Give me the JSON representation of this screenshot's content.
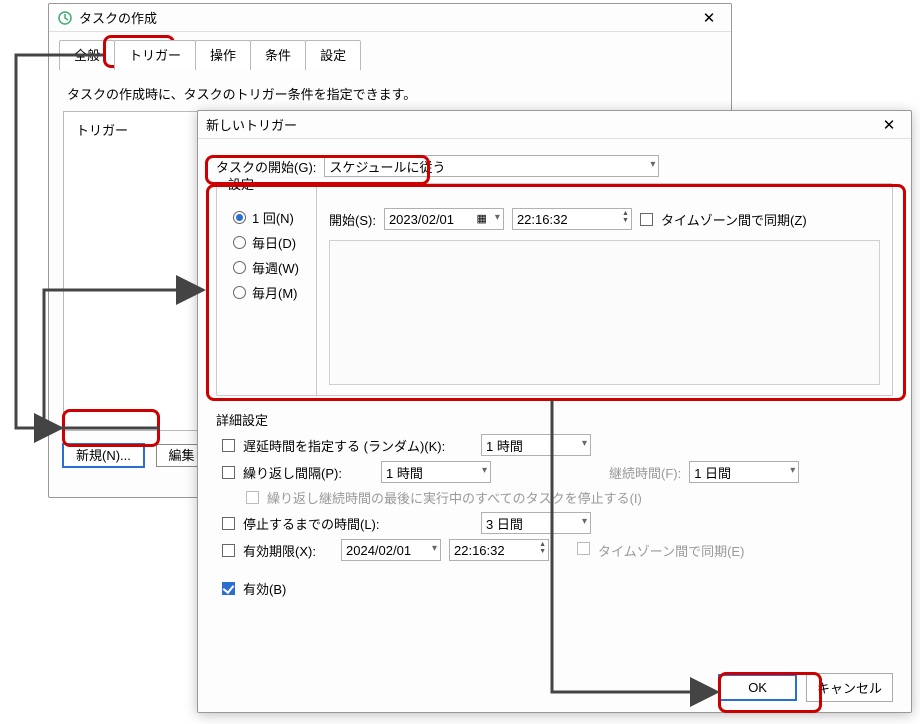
{
  "back": {
    "title": "タスクの作成",
    "close": "✕",
    "tabs": {
      "general": "全般",
      "triggers": "トリガー",
      "actions": "操作",
      "conditions": "条件",
      "settings": "設定"
    },
    "desc": "タスクの作成時に、タスクのトリガー条件を指定できます。",
    "column_trigger": "トリガー",
    "btn_new": "新規(N)...",
    "btn_edit": "編集"
  },
  "front": {
    "title": "新しいトリガー",
    "close": "✕",
    "begin_label": "タスクの開始(G):",
    "begin_value": "スケジュールに従う",
    "settings_label": "設定",
    "freq": {
      "once": "1 回(N)",
      "daily": "毎日(D)",
      "weekly": "毎週(W)",
      "monthly": "毎月(M)"
    },
    "start_label": "開始(S):",
    "start_date": "2023/02/01",
    "start_time": "22:16:32",
    "tz_sync": "タイムゾーン間で同期(Z)",
    "advanced_label": "詳細設定",
    "adv": {
      "delay": {
        "label": "遅延時間を指定する (ランダム)(K):",
        "value": "1 時間"
      },
      "repeat": {
        "label": "繰り返し間隔(P):",
        "value": "1 時間",
        "duration_label": "継続時間(F):",
        "duration_value": "1 日間"
      },
      "stop_all": "繰り返し継続時間の最後に実行中のすべてのタスクを停止する(I)",
      "stop": {
        "label": "停止するまでの時間(L):",
        "value": "3 日間"
      },
      "expire": {
        "label": "有効期限(X):",
        "date": "2024/02/01",
        "time": "22:16:32",
        "tz": "タイムゾーン間で同期(E)"
      },
      "enabled": "有効(B)"
    },
    "ok": "OK",
    "cancel": "キャンセル"
  }
}
